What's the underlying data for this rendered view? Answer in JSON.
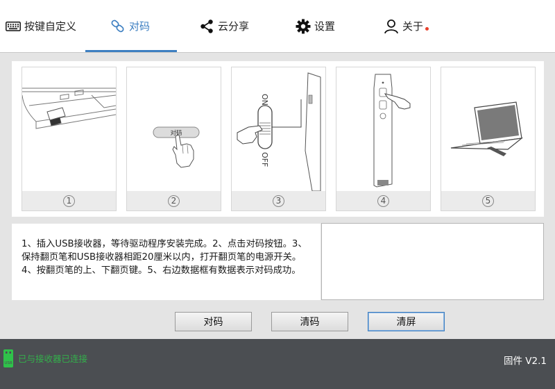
{
  "tabs": [
    {
      "label": "按键自定义",
      "icon": "keyboard-icon",
      "active": false
    },
    {
      "label": "对码",
      "icon": "link-icon",
      "active": true
    },
    {
      "label": "云分享",
      "icon": "share-icon",
      "active": false
    },
    {
      "label": "设置",
      "icon": "gear-icon",
      "active": false
    },
    {
      "label": "关于",
      "icon": "user-icon",
      "active": false,
      "notification": true
    }
  ],
  "steps": [
    {
      "number": "1",
      "illustration": "usb-receiver-into-laptop",
      "button_text": ""
    },
    {
      "number": "2",
      "illustration": "press-pair-button",
      "button_text": "对码"
    },
    {
      "number": "3",
      "illustration": "on-off-switch",
      "on_label": "ON",
      "off_label": "OFF"
    },
    {
      "number": "4",
      "illustration": "press-page-keys"
    },
    {
      "number": "5",
      "illustration": "laptop-connected"
    }
  ],
  "instructions": "1、插入USB接收器，等待驱动程序安装完成。2、点击对码按钮。3、保持翻页笔和USB接收器相距20厘米以内，打开翻页笔的电源开关。4、按翻页笔的上、下翻页键。5、右边数据框有数据表示对码成功。",
  "log": "",
  "buttons": {
    "pair": "对码",
    "clear_pair": "清码",
    "clear_screen": "清屏"
  },
  "status": {
    "usb_text": "已与接收器已连接",
    "firmware": "固件 V2.1"
  },
  "colors": {
    "accent": "#3d7fc1",
    "status_bar": "#4b4e52",
    "status_ok": "#2fc24a",
    "notify": "#e8402b"
  }
}
